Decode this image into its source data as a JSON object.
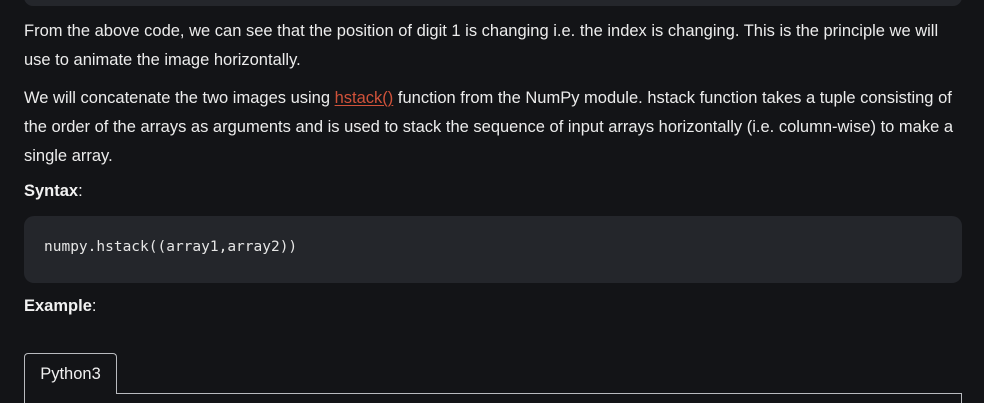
{
  "article": {
    "paragraph1": "From the above code, we can see that the position of digit 1 is changing i.e. the index is changing. This is the principle we will use to animate the image horizontally.",
    "paragraph2_before": "We will concatenate the two images using ",
    "paragraph2_link": "hstack()",
    "paragraph2_after": " function from the NumPy module. hstack function takes a tuple consisting of the order of the arrays as arguments and is used to stack the sequence of input arrays horizontally (i.e. column-wise) to make a single array.",
    "syntax_heading": "Syntax",
    "syntax_colon": ":",
    "syntax_code": "numpy.hstack((array1,array2))",
    "example_heading": "Example",
    "example_colon": ":",
    "tabs": [
      {
        "label": "Python3"
      }
    ]
  },
  "colors": {
    "background": "#131417",
    "code_background": "#24262b",
    "link": "#d0523a",
    "text": "#ececec"
  }
}
